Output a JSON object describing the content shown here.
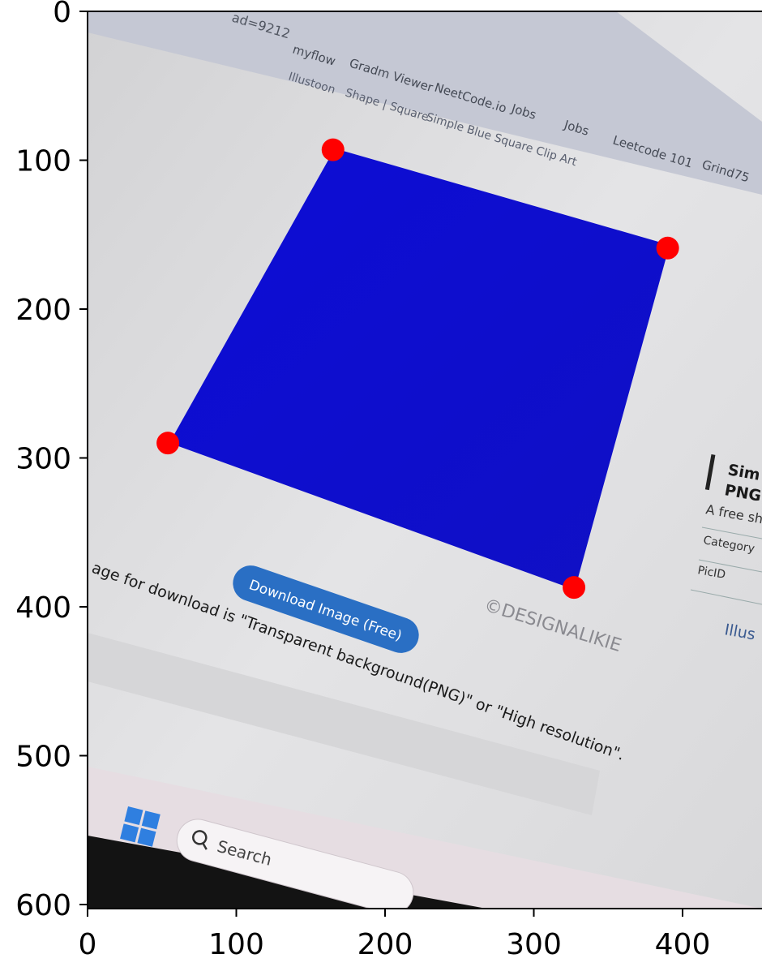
{
  "axes": {
    "x_ticks": [
      "0",
      "100",
      "200",
      "300",
      "400"
    ],
    "y_ticks": [
      "0",
      "100",
      "200",
      "300",
      "400",
      "500",
      "600"
    ]
  },
  "photo": {
    "url_fragment": "ad=9212",
    "bookmarks": [
      "myflow",
      "Gradm Viewer",
      "NeetCode.io",
      "Jobs",
      "Jobs",
      "Leetcode 101",
      "Grind75"
    ],
    "breadcrumb": [
      "Illustoon",
      "Shape | Square",
      "Simple Blue Square Clip Art"
    ],
    "download_button": "Download Image (Free)",
    "watermark": "©DESIGNALIKIE",
    "note": "age for download is \"Transparent background(PNG)\" or \"High resolution\".",
    "side_title_1": "Sim",
    "side_title_2": "PNG",
    "side_desc": "A free sh",
    "side_row_1": "Category",
    "side_row_2": "PicID",
    "side_link": "Illus",
    "taskbar_search": "Search",
    "square_color": "#1414c8"
  },
  "markers": {
    "color": "#ff0000",
    "points": [
      [
        165,
        93
      ],
      [
        390,
        159
      ],
      [
        327,
        387
      ],
      [
        54,
        290
      ]
    ]
  }
}
